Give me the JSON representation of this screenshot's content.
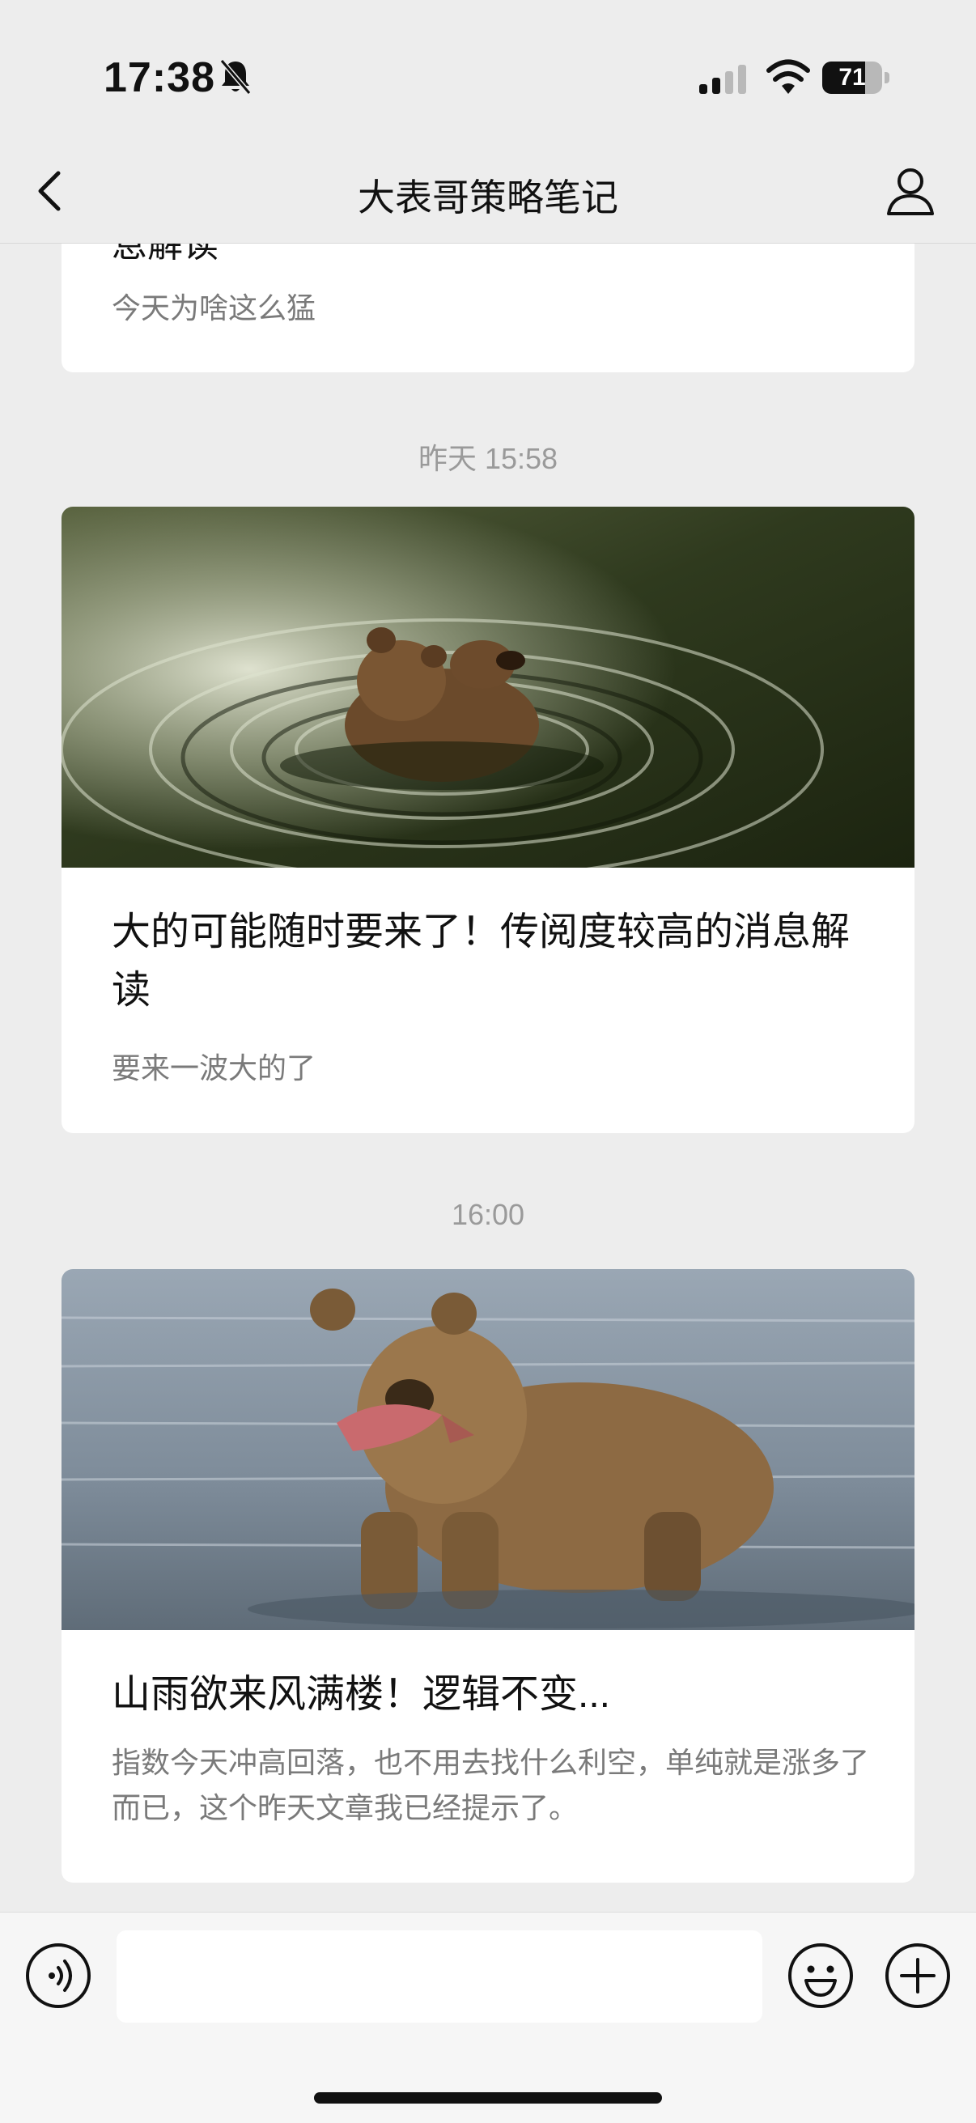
{
  "status_bar": {
    "time": "17:38",
    "battery_percent": "71",
    "battery_level": 0.71,
    "icons": [
      "bell-muted-icon",
      "cellular-signal-icon",
      "wifi-icon",
      "battery-icon"
    ]
  },
  "nav": {
    "title": "大表哥策略笔记",
    "icons": [
      "back-chevron-icon",
      "profile-icon"
    ]
  },
  "feed": {
    "partial": {
      "title_fragment": "息解读",
      "digest": "今天为啥这么猛"
    },
    "timestamps": [
      "昨天 15:58",
      "16:00"
    ],
    "articles": [
      {
        "title": "大的可能随时要来了！传阅度较高的消息解读",
        "digest": "要来一波大的了",
        "image": "bear-in-water-photo"
      },
      {
        "title": "山雨欲来风满楼！逻辑不变...",
        "digest": "指数今天冲高回落，也不用去找什么利空，单纯就是涨多了而已，这个昨天文章我已经提示了。",
        "image": "bear-with-fish-photo"
      }
    ]
  },
  "input_bar": {
    "text_value": "",
    "icons": [
      "voice-icon",
      "emoji-icon",
      "plus-icon"
    ]
  },
  "colors": {
    "background": "#ededed",
    "card": "#ffffff",
    "digest_text": "#7a7a7a",
    "timestamp_text": "#9a9a9a"
  }
}
